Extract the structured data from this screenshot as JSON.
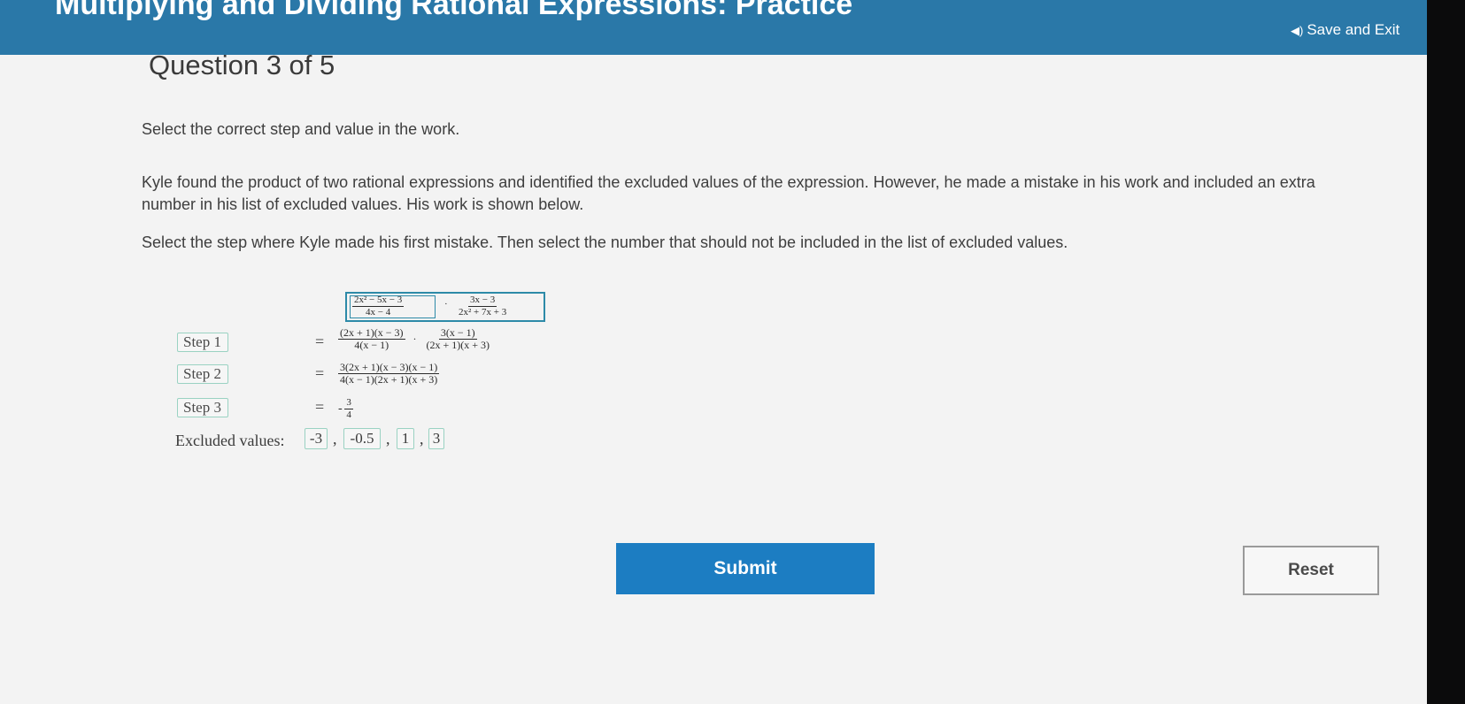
{
  "header": {
    "title": "Multiplying and Dividing Rational Expressions: Practice",
    "save_exit_icon": "speaker-icon",
    "save_exit_label": "Save and Exit",
    "bg_color": "#2a78a8"
  },
  "question": {
    "counter": "Question 3 of 5",
    "instruction": "Select the correct step and value in the work.",
    "description": "Kyle found the product of two rational expressions and identified the excluded values of the expression. However, he made a mistake in his work and included an extra number in his list of excluded values. His work is shown below.",
    "task": "Select the step where Kyle made his first mistake. Then select the number that should not be included in the list of excluded values."
  },
  "work": {
    "expression": {
      "f1_num": "2x² − 5x − 3",
      "f1_den": "4x − 4",
      "dot": "·",
      "f2_num": "3x − 3",
      "f2_den": "2x² + 7x + 3"
    },
    "steps": [
      {
        "label": "Step 1",
        "eq": "=",
        "f1_num": "(2x + 1)(x − 3)",
        "f1_den": "4(x − 1)",
        "dot": "·",
        "f2_num": "3(x − 1)",
        "f2_den": "(2x + 1)(x + 3)"
      },
      {
        "label": "Step 2",
        "eq": "=",
        "num": "3(2x + 1)(x − 3)(x − 1)",
        "den": "4(x − 1)(2x + 1)(x + 3)"
      },
      {
        "label": "Step 3",
        "eq": "=",
        "sign": "-",
        "num": "3",
        "den": "4"
      }
    ],
    "excluded_label": "Excluded values:",
    "excluded_values": [
      "-3",
      "-0.5",
      "1",
      "3"
    ],
    "separator": ","
  },
  "actions": {
    "submit_label": "Submit",
    "reset_label": "Reset",
    "submit_color": "#1c7dc2"
  }
}
